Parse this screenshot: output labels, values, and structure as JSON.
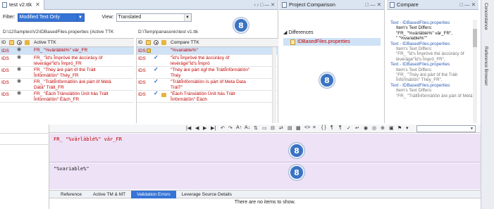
{
  "compare_panel": {
    "tab_title": "test v2.ttk",
    "tab_controls": "‹ › □ — ✕",
    "filter_label": "Filter:",
    "filter_value": "Modified Text Only",
    "view_label": "View:",
    "view_value": "Translated",
    "left_path": "D:\\12Samples\\V2\\IDBasedFiles.properties (Active TTK",
    "right_path": "D:\\Temp\\panasonic\\test v1.ttk",
    "left_headers": {
      "id": "ID",
      "col": "Active TTK"
    },
    "right_headers": {
      "id": "ID",
      "col": "Compare TTK"
    },
    "left_rows": [
      {
        "id": "IDS",
        "lines": [
          "FR_ \"%värläblé%\" vär_FR"
        ]
      },
      {
        "id": "IDS",
        "lines": [
          "FR_ \"Ïd's Împrövé thé äccüräcy öf",
          "lévérägé\"Ïd's Împrö_FR"
        ]
      },
      {
        "id": "IDS",
        "lines": [
          "FR_ \"Théy äré pärt öf thé Trält",
          "Înförmätïön\" Théy_FR"
        ]
      },
      {
        "id": "IDS",
        "lines": [
          "FR_ \"TrältÎnförmätïön äré pärt öf Métä",
          "Dätä\" Trält_FR"
        ]
      },
      {
        "id": "IDS",
        "lines": [
          "FR_ \"Ëäch Tränslätïön Ünït häs Trält",
          "Înförmätïön\" Ëäch_FR"
        ]
      }
    ],
    "right_rows": [
      {
        "id": "IDS",
        "lines": [
          "\"%variable%\""
        ]
      },
      {
        "id": "IDS",
        "lines": [
          "\"Ïd's Împrövé thé äccüräcy öf",
          "lévérägé\"Ïd's Împrö"
        ]
      },
      {
        "id": "IDS",
        "lines": [
          "\"Théy äré pärt ögf thé TrältÎnförmätïön\"",
          "Théy"
        ]
      },
      {
        "id": "IDS",
        "lines": [
          "\"TrältÎnförmätïön ïs pärt öf Meta Data",
          "TrälT\""
        ]
      },
      {
        "id": "IDS",
        "lines": [
          "\"Ëäch Tränslätïön Ünït häs Trält",
          "Înförmätïön\" Ëäch"
        ]
      }
    ]
  },
  "project_panel": {
    "title": "Project Comparison",
    "differences_label": "Differences",
    "file_item": "IDBasedFiles.properties"
  },
  "right_compare": {
    "title": "Compare",
    "entries": [
      {
        "link": "Text - IDBasedFiles.properties",
        "lines": [
          "Item's Text Differs:",
          "\"FR_ \"%värläblé%\" vär_FR\",",
          "\" \"%variable%\"\""
        ],
        "state": "selected"
      },
      {
        "link": "Text - IDBasedFiles.properties",
        "lines": [
          "Item's Text Differs:",
          "\"FR_ \"Ïd's Împrövé thé äccüräcy öf",
          "lévérägé\"Ïd's Împrö_FR\","
        ],
        "state": "dim"
      },
      {
        "link": "Text - IDBasedFiles.properties",
        "lines": [
          "Item's Text Differs:",
          "\"FR_ \"Théy äré pärt öf thé Trält",
          "Înförmätïön\" Théy_FR\","
        ],
        "state": "dim"
      },
      {
        "link": "Text - IDBasedFiles.properties",
        "lines": [
          "Item's Text Differs:",
          "\"FR_ \"TrältÎnförmätïön äré pärt öf Métä"
        ],
        "state": "dim"
      }
    ]
  },
  "side_tabs": {
    "concordance": "Concordance",
    "reference_browser": "Reference Browser"
  },
  "editor": {
    "source_text": "FR_ \"%värläblé%\" vär_FR",
    "target_text": "\"%variable%\""
  },
  "badge_label": "8",
  "bottom_tabs": [
    "Reference",
    "Active TM & MT",
    "Validation Errors",
    "Leverage Source Details"
  ],
  "active_bottom_tab": "Validation Errors",
  "empty_message": "There are no items to show.",
  "colors": {
    "accent": "#3574d6",
    "error_text": "#c00000",
    "editor_bg": "#ede2f6",
    "selection": "#cfe2f6",
    "badge": "#3a73c4"
  }
}
